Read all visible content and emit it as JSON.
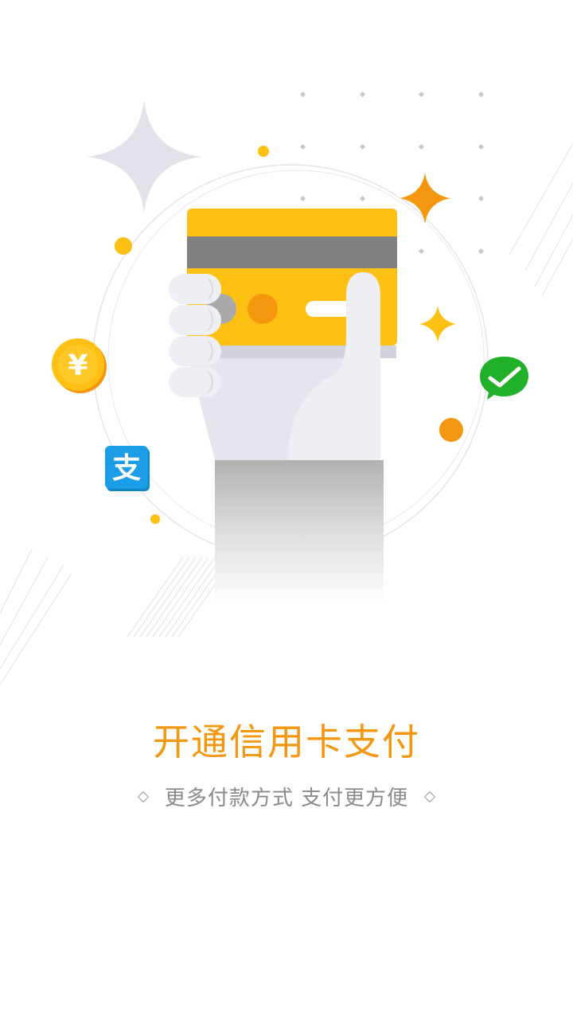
{
  "illustration": {
    "coin_symbol": "¥",
    "alipay_symbol": "支"
  },
  "promo": {
    "title": "开通信用卡支付",
    "subtitle": "更多付款方式 支付更方便"
  },
  "colors": {
    "accent": "#f5960f",
    "card_yellow": "#ffc014",
    "wechat_green": "#21b02a",
    "alipay_blue": "#1b9de8"
  },
  "icons": [
    "sparkle-star-icon",
    "coin-yen-icon",
    "alipay-icon",
    "wechat-pay-icon",
    "credit-card-icon",
    "hand-icon"
  ]
}
